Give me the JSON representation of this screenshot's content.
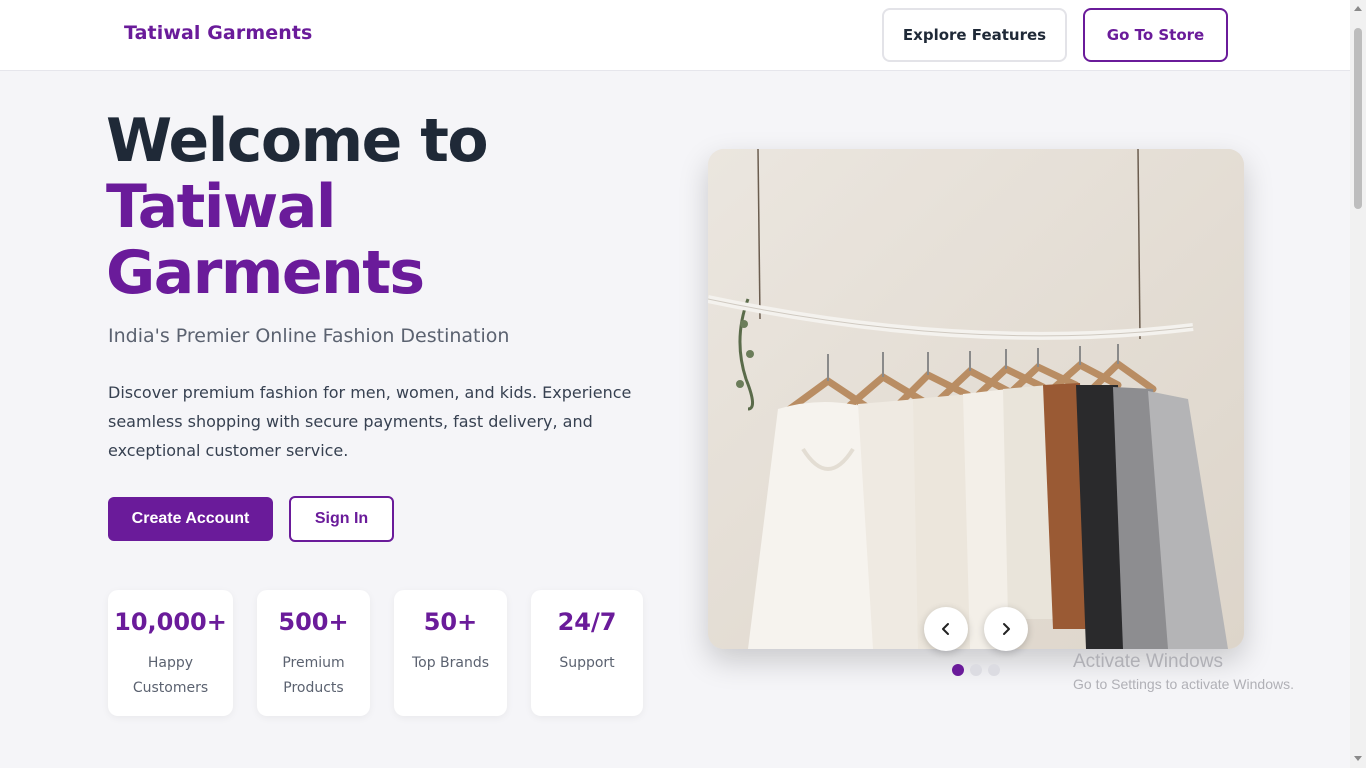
{
  "header": {
    "brand": "Tatiwal Garments",
    "explore_label": "Explore Features",
    "store_label": "Go To Store"
  },
  "hero": {
    "title_line1": "Welcome to",
    "title_line2": "Tatiwal",
    "title_line3": "Garments",
    "subtitle": "India's Premier Online Fashion Destination",
    "description": "Discover premium fashion for men, women, and kids. Experience seamless shopping with secure payments, fast delivery, and exceptional customer service.",
    "create_account_label": "Create Account",
    "sign_in_label": "Sign In"
  },
  "stats": [
    {
      "value": "10,000+",
      "label": "Happy Customers"
    },
    {
      "value": "500+",
      "label": "Premium Products"
    },
    {
      "value": "50+",
      "label": "Top Brands"
    },
    {
      "value": "24/7",
      "label": "Support"
    }
  ],
  "carousel": {
    "image_icon": "clothes-rack-photo",
    "prev_icon": "chevron-left-icon",
    "next_icon": "chevron-right-icon",
    "slide_count": 3,
    "active_slide": 1
  },
  "watermark": {
    "title": "Activate Windows",
    "subtitle": "Go to Settings to activate Windows."
  },
  "colors": {
    "brand": "#6a1b9a",
    "heading": "#1f2937",
    "background": "#f5f5f8"
  }
}
